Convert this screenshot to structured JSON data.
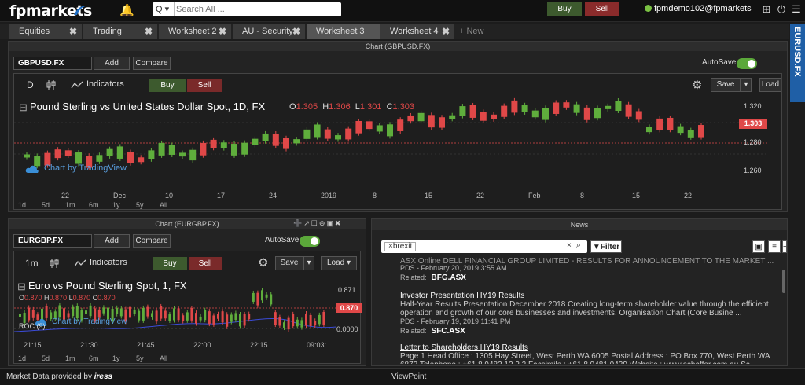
{
  "header": {
    "logo": "fpmarkets",
    "search_dropdown": "Q ▾",
    "search_placeholder": "Search All ...",
    "buy_label": "Buy",
    "sell_label": "Sell",
    "user": "fpmdemo102@fpmarkets"
  },
  "tabs": [
    {
      "label": "Equities"
    },
    {
      "label": "Trading"
    },
    {
      "label": "Worksheet 2"
    },
    {
      "label": "AU - Security"
    },
    {
      "label": "Worksheet 3"
    },
    {
      "label": "Worksheet 4"
    }
  ],
  "tab_new": "+ New",
  "side_tab": "EURUSD.FX",
  "chart_main": {
    "title": "Chart (GBPUSD.FX)",
    "symbol": "GBPUSD.FX",
    "add": "Add",
    "compare": "Compare",
    "autosave": "AutoSave",
    "interval": "D",
    "indicators": "Indicators",
    "buy": "Buy",
    "sell": "Sell",
    "save": "Save",
    "load": "Load",
    "series_title": "Pound Sterling vs United States Dollar Spot, 1D, FX",
    "ohlc": {
      "o": "1.305",
      "h": "1.306",
      "l": "1.301",
      "c": "1.303"
    },
    "watermark": "Chart by TradingView",
    "price_label": "1.303",
    "y_ticks": [
      "1.320",
      "1.300",
      "1.280",
      "1.260"
    ],
    "x_ticks": [
      "22",
      "Dec",
      "10",
      "17",
      "24",
      "2019",
      "8",
      "15",
      "22",
      "Feb",
      "8",
      "15",
      "22"
    ],
    "ranges": [
      "1d",
      "5d",
      "1m",
      "6m",
      "1y",
      "5y",
      "All"
    ]
  },
  "chart_small": {
    "title": "Chart (EURGBP.FX)",
    "symbol": "EURGBP.FX",
    "add": "Add",
    "compare": "Compare",
    "autosave": "AutoSave",
    "interval": "1m",
    "indicators": "Indicators",
    "buy": "Buy",
    "sell": "Sell",
    "save": "Save",
    "load": "Load",
    "series_title": "Euro vs Pound Sterling Spot, 1, FX",
    "ohlc": {
      "o": "0.870",
      "h": "0.870",
      "l": "0.870",
      "c": "0.870"
    },
    "watermark": "Chart by TradingView",
    "indicator_name": "ROC (9)",
    "price_label": "0.870",
    "y_ticks": [
      "0.871",
      "0.0000"
    ],
    "x_ticks": [
      "21:15",
      "21:30",
      "21:45",
      "22:00",
      "22:15",
      "09:03:"
    ],
    "ranges": [
      "1d",
      "5d",
      "1m",
      "6m",
      "1y",
      "5y",
      "All"
    ]
  },
  "news": {
    "title": "News",
    "filter_tag": "brexit",
    "filter_button": "Filter",
    "items": [
      {
        "headline": "ASX Online DELL FINANCIAL GROUP LIMITED - RESULTS FOR ANNOUNCEMENT TO THE MARKET ...",
        "meta": "PDS  -  February 20, 2019 3:55 AM",
        "related_label": "Related:",
        "related": "BFG.ASX"
      },
      {
        "headline": "Investor Presentation HY19 Results",
        "body": "Half-Year Results Presentation December 2018 Creating long-term shareholder value through the efficient operation and growth of our core businesses and investments. Organisation Chart (Core Busine ...",
        "meta": "PDS  -  February 19, 2019 11:41 PM",
        "related_label": "Related:",
        "related": "SFC.ASX"
      },
      {
        "headline": "Letter to Shareholders HY19 Results",
        "body": "Page 1 Head Office : 1305 Hay Street, West Perth WA 6005 Postal Address : PO Box 770, West Perth WA 6872 Telephone : +61 8 9483 12 2 2 Facsimile : +61 8 9481 0439 Website : www.schaffer.com.au Sc ..."
      }
    ]
  },
  "footer": {
    "provider": "Market Data provided by",
    "provider_brand": "iress",
    "center": "ViewPoint"
  },
  "colors": {
    "up": "#5fae3c",
    "down": "#e04848",
    "accent": "#1f5fa6"
  }
}
